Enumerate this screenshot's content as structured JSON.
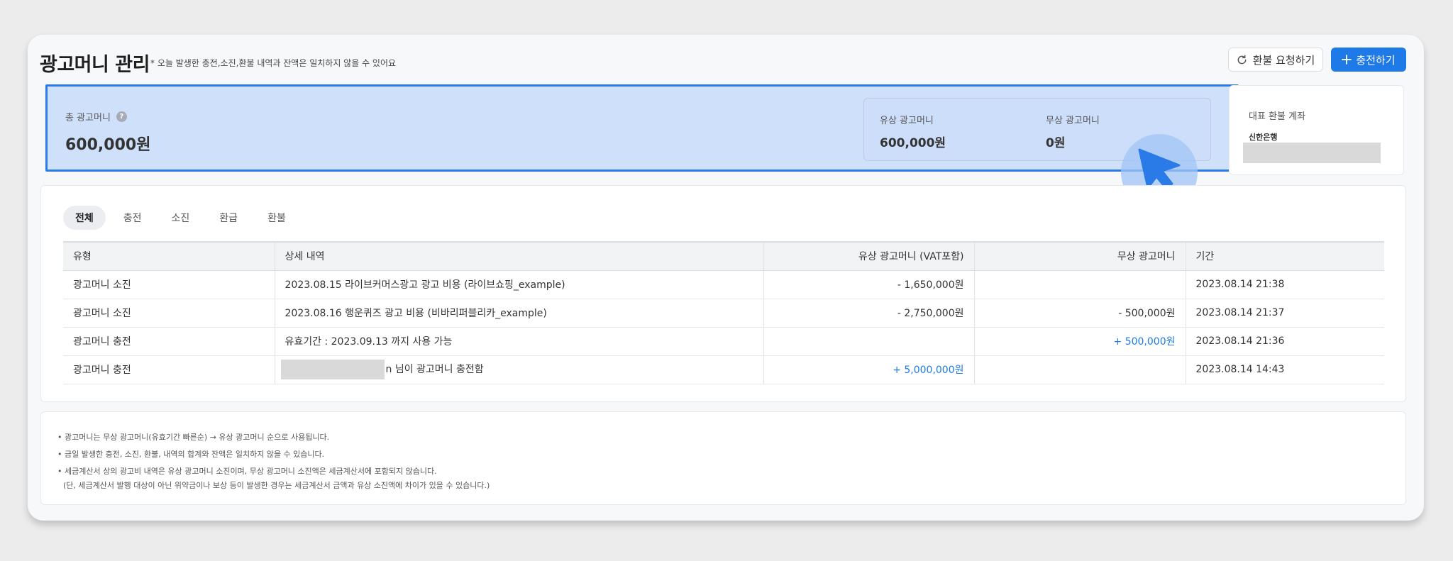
{
  "header": {
    "title": "광고머니 관리",
    "subtitle": "* 오늘 발생한 충전,소진,환불 내역과 잔액은 일치하지 않을 수 있어요",
    "refund_button": "환불 요청하기",
    "charge_button": "충전하기"
  },
  "balance": {
    "total_label": "총 광고머니",
    "total_amount": "600,000원",
    "paid_label": "유상 광고머니",
    "paid_amount": "600,000원",
    "free_label": "무상 광고머니",
    "free_amount": "0원"
  },
  "account": {
    "title": "대표 환불 계좌",
    "bank": "신한은행"
  },
  "tabs": [
    "전체",
    "충전",
    "소진",
    "환급",
    "환불"
  ],
  "table": {
    "headers": [
      "유형",
      "상세 내역",
      "유상 광고머니 (VAT포함)",
      "무상 광고머니",
      "기간"
    ],
    "rows": [
      {
        "type": "광고머니 소진",
        "detail": "2023.08.15 라이브커머스광고 광고 비용 (라이브쇼핑_example)",
        "paid": "- 1,650,000원",
        "free": "",
        "date": "2023.08.14 21:38"
      },
      {
        "type": "광고머니 소진",
        "detail": "2023.08.16 행운퀴즈 광고 비용 (비바리퍼블리카_example)",
        "paid": "- 2,750,000원",
        "free": "- 500,000원",
        "date": "2023.08.14 21:37"
      },
      {
        "type": "광고머니 충전",
        "detail": "유효기간 : 2023.09.13 까지 사용 가능",
        "paid": "",
        "free": "+ 500,000원",
        "date": "2023.08.14 21:36"
      },
      {
        "type": "광고머니 충전",
        "detail": "n 님이 광고머니 충전함",
        "paid": "+ 5,000,000원",
        "free": "",
        "date": "2023.08.14 14:43"
      }
    ]
  },
  "notes": [
    "• 광고머니는 무상 광고머니(유효기간 빠른순) → 유상 광고머니 순으로 사용됩니다.",
    "• 금일 발생한 충전, 소진, 환불, 내역의 합계와 잔액은 일치하지 않을 수 있습니다.",
    "• 세금계산서 상의 광고비 내역은 유상 광고머니 소진이며, 무상 광고머니 소진액은 세금계산서에 포함되지 않습니다.",
    "(단, 세금계산서 발행 대상이 아닌 위약금이나 보상 등이 발생한 경우는 세금계산서 금액과 유상 소진액에 차이가 있을 수 있습니다.)"
  ],
  "colors": {
    "accent": "#1e7ae6",
    "highlight": "#cfe0fb"
  },
  "icons": [
    "refresh-icon",
    "plus-icon",
    "help-icon",
    "cursor-icon"
  ]
}
